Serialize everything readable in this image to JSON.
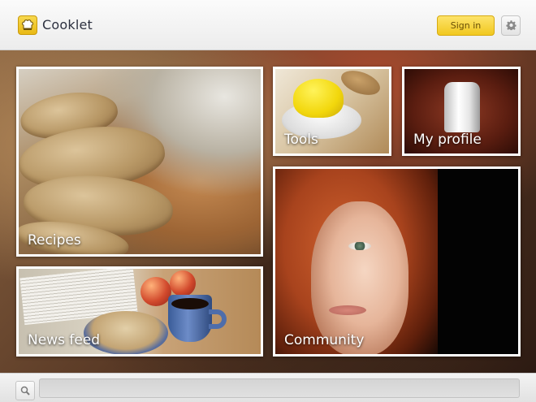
{
  "header": {
    "app_name": "Cooklet",
    "logo_icon": "chef-hat-icon",
    "signin_label": "Sign in",
    "settings_icon": "gear-icon"
  },
  "tiles": {
    "recipes": "Recipes",
    "tools": "Tools",
    "my_profile": "My profile",
    "news_feed": "News feed",
    "community": "Community"
  },
  "footer": {
    "search_icon": "search-icon",
    "search_value": "",
    "search_placeholder": ""
  },
  "colors": {
    "accent": "#f1c81f",
    "brand_text": "#2d3140"
  }
}
